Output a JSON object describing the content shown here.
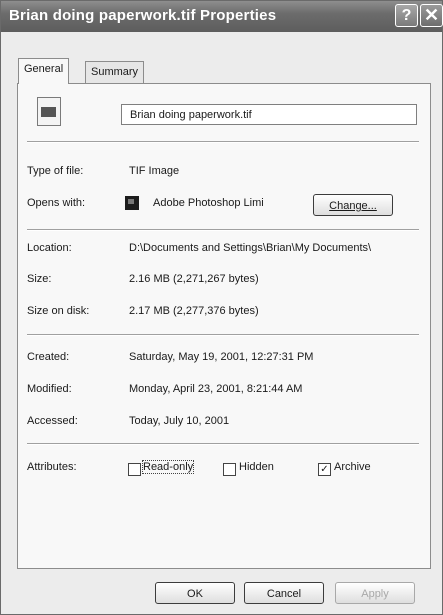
{
  "window": {
    "title": "Brian doing paperwork.tif Properties",
    "help_label": "?",
    "close_label": "✕"
  },
  "tabs": [
    {
      "label": "General",
      "active": true
    },
    {
      "label": "Summary",
      "active": false
    }
  ],
  "file": {
    "name": "Brian doing paperwork.tif",
    "icon": "tif-image-file-icon"
  },
  "general": {
    "type_label": "Type of file:",
    "type_value": "TIF Image",
    "opens_label": "Opens with:",
    "opens_value": "Adobe Photoshop Limi",
    "opens_icon": "photoshop-app-icon",
    "change_label": "Change...",
    "location_label": "Location:",
    "location_value": "D:\\Documents and Settings\\Brian\\My Documents\\",
    "size_label": "Size:",
    "size_value": "2.16 MB (2,271,267 bytes)",
    "size_disk_label": "Size on disk:",
    "size_disk_value": "2.17 MB (2,277,376 bytes)",
    "created_label": "Created:",
    "created_value": "Saturday, May 19, 2001, 12:27:31 PM",
    "modified_label": "Modified:",
    "modified_value": "Monday, April 23, 2001, 8:21:44 AM",
    "accessed_label": "Accessed:",
    "accessed_value": "Today, July 10, 2001"
  },
  "attributes": {
    "label": "Attributes:",
    "readonly": {
      "label": "Read-only",
      "checked": false
    },
    "hidden": {
      "label": "Hidden",
      "checked": false
    },
    "archive": {
      "label": "Archive",
      "checked": true
    }
  },
  "buttons": {
    "ok": "OK",
    "cancel": "Cancel",
    "apply": "Apply"
  }
}
